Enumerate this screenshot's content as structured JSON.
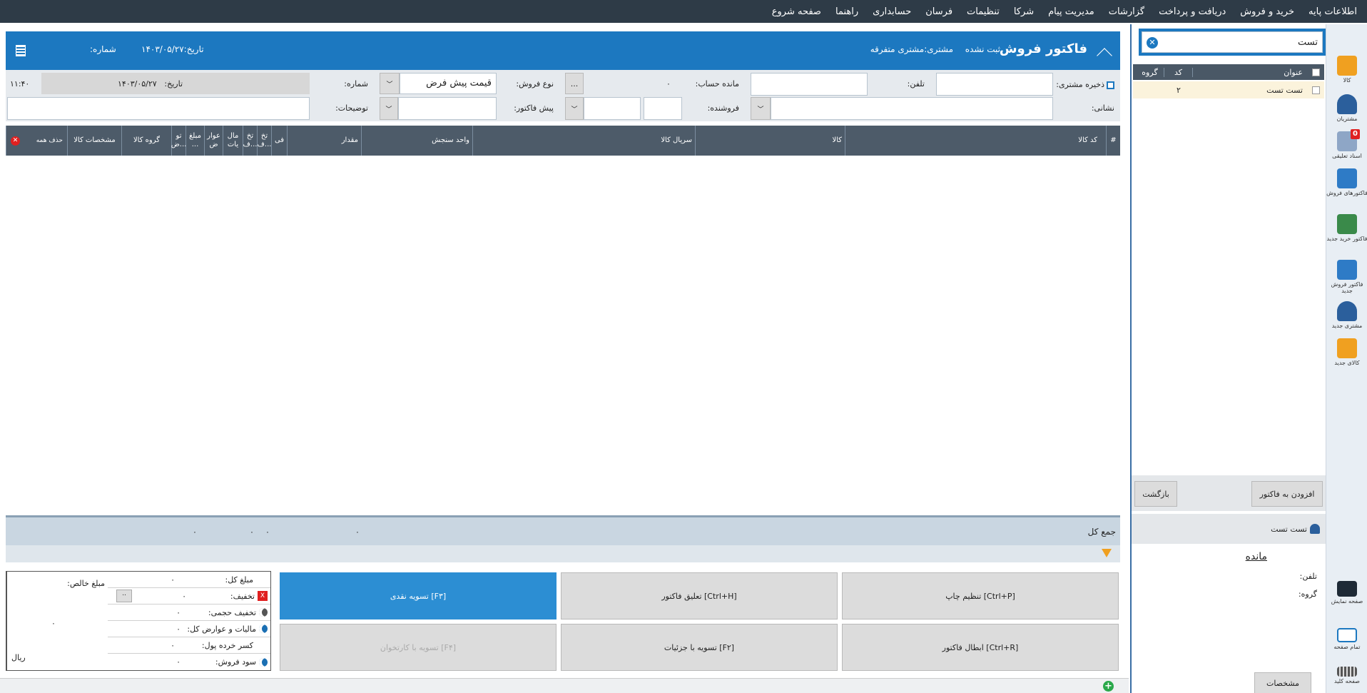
{
  "menu": [
    "اطلاعات پایه",
    "خرید و فروش",
    "دریافت و پرداخت",
    "گزارشات",
    "مدیریت پیام",
    "شرکا",
    "تنظیمات",
    "فرسان",
    "حسابداری",
    "راهنما",
    "صفحه شروع"
  ],
  "rail": [
    {
      "label": "کالا",
      "icon": "box-icon",
      "color": "#f0a020"
    },
    {
      "label": "مشتریان",
      "icon": "customer-icon",
      "color": "#2b5f9c"
    },
    {
      "label": "اسناد تعلیقی",
      "icon": "suspended-docs-icon",
      "color": "#6d8bb5",
      "badge": "0"
    },
    {
      "label": "فاکتورهای فروش",
      "icon": "sales-invoices-icon",
      "color": "#2e7bc6"
    },
    {
      "label": "فاکتور خرید جدید",
      "icon": "new-purchase-invoice-icon",
      "color": "#3a8a4a"
    },
    {
      "label": "فاکتور فروش جدید",
      "icon": "new-sales-invoice-icon",
      "color": "#2e7bc6"
    },
    {
      "label": "مشتری جدید",
      "icon": "new-customer-icon",
      "color": "#2b5f9c"
    },
    {
      "label": "کالای جدید",
      "icon": "new-product-icon",
      "color": "#f0a020"
    }
  ],
  "rail_bottom": [
    {
      "label": "صفحه نمایش",
      "icon": "monitor-icon"
    },
    {
      "label": "تمام صفحه",
      "icon": "fullscreen-icon"
    },
    {
      "label": "صفحه کلید",
      "icon": "keyboard-icon"
    }
  ],
  "search": {
    "value": "تست"
  },
  "product_table": {
    "headers": [
      "عنوان",
      "کد",
      "گروه"
    ],
    "rows": [
      {
        "title": "تست تست",
        "code": "۲",
        "group": ""
      }
    ]
  },
  "panel_buttons": {
    "add": "افزودن به فاکتور",
    "back": "بازگشت"
  },
  "customer_card": {
    "name": "تست تست",
    "balance_title": "مانده",
    "phone_label": "تلفن:",
    "group_label": "گروه:",
    "details": "مشخصات"
  },
  "invoice": {
    "title": "فاکتور فروش",
    "status": "ثبت نشده",
    "customer_label": "مشتری:",
    "customer": "مشتری متفرقه",
    "date_label": "تاریخ:",
    "date": "۱۴۰۳/۰۵/۲۷",
    "number_label": "شماره:"
  },
  "form": {
    "save_customer": "ذخیره مشتری:",
    "phone": "تلفن:",
    "balance": "مانده حساب:",
    "balance_value": "۰",
    "sale_type": "نوع فروش:",
    "sale_type_value": "قیمت پیش فرض",
    "number": "شماره:",
    "date": "تاریخ:",
    "date_value": "۱۴۰۳/۰۵/۲۷",
    "time": "۱۱:۴۰",
    "address": "نشانی:",
    "seller": "فروشنده:",
    "proforma": "پیش فاکتور:",
    "description": "توضیحات:",
    "ellipsis": "..."
  },
  "grid_headers": [
    "#",
    "کد کالا",
    "کالا",
    "سریال کالا",
    "واحد سنجش",
    "مقدار",
    "فی",
    "تخ ف...",
    "تخ ف...",
    "مال یات",
    "عوار ض",
    "مبلغ ...",
    "تو ض...",
    "گروه کالا",
    "مشخصات کالا",
    "حذف همه"
  ],
  "totals": {
    "label": "جمع کل",
    "values": [
      "۰",
      "۰",
      "۰",
      "۰"
    ]
  },
  "summary": {
    "rows": [
      {
        "label": "مبلغ کل:",
        "value": "۰"
      },
      {
        "label": "تخفیف:",
        "value": "۰"
      },
      {
        "label": "تخفیف حجمی:",
        "value": "۰"
      },
      {
        "label": "مالیات و عوارض کل:",
        "value": "۰"
      },
      {
        "label": "کسر خرده پول:",
        "value": "۰"
      },
      {
        "label": "سود فروش:",
        "value": "۰"
      }
    ],
    "net_label": "مبلغ خالص:",
    "net_value": "۰",
    "currency": "ریال",
    "x": "X",
    "dots": ".."
  },
  "actions": [
    {
      "label": "تنظیم چاپ [Ctrl+P]"
    },
    {
      "label": "تعلیق فاکتور [Ctrl+H]"
    },
    {
      "label": "تسویه نقدی [F۳]"
    },
    {
      "label": "ابطال فاکتور [Ctrl+R]"
    },
    {
      "label": "تسویه با جزئیات [F۲]"
    },
    {
      "label": "تسویه با کارتخوان [F۴]"
    }
  ]
}
